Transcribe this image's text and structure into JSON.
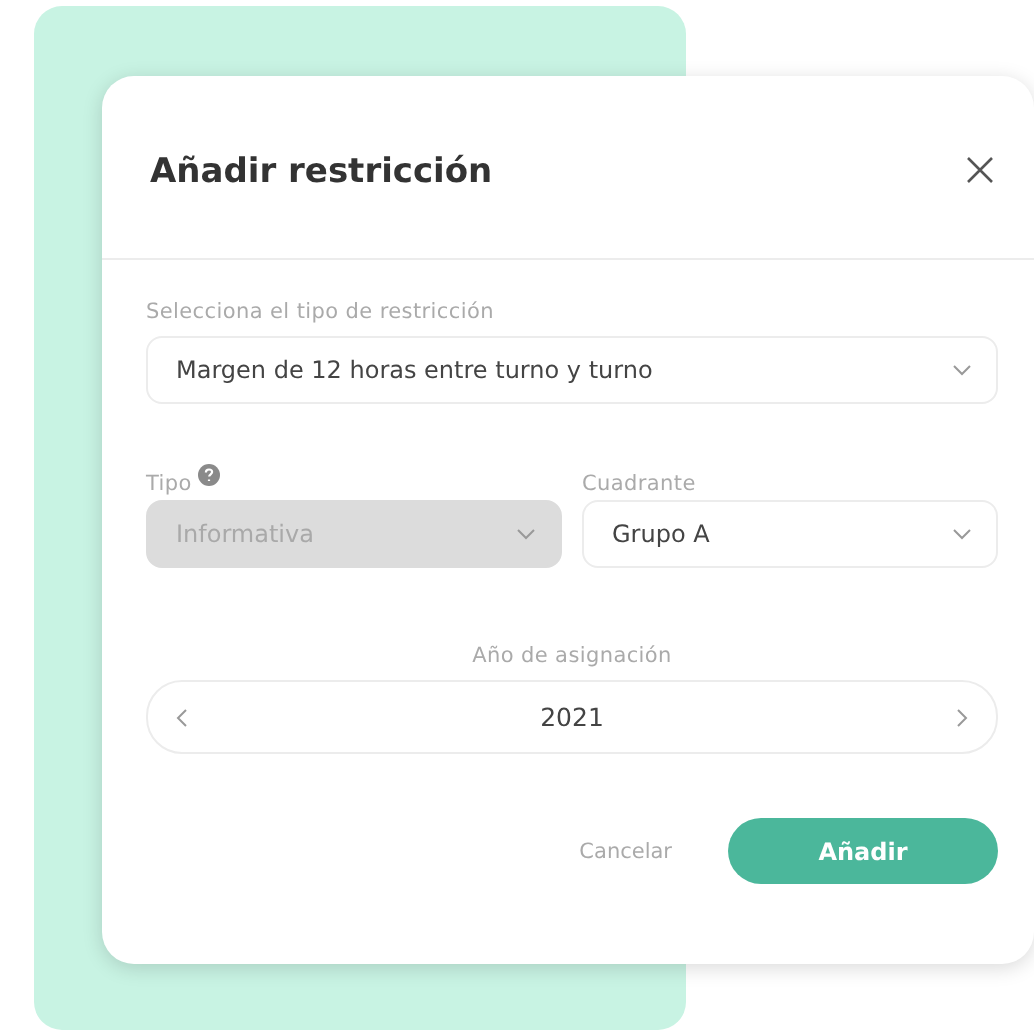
{
  "dialog": {
    "title": "Añadir restricción",
    "restriction_type": {
      "label": "Selecciona el tipo de restricción",
      "value": "Margen de 12 horas entre turno y turno",
      "disabled": false
    },
    "fields": [
      {
        "label": "Tipo",
        "help": true,
        "value": "Informativa",
        "disabled": true
      },
      {
        "label": "Cuadrante",
        "help": false,
        "value": "Grupo A",
        "disabled": false
      }
    ],
    "year": {
      "label": "Año de asignación",
      "value": "2021"
    },
    "buttons": [
      {
        "label": "Cancelar",
        "kind": "secondary"
      },
      {
        "label": "Añadir",
        "kind": "primary"
      }
    ]
  }
}
